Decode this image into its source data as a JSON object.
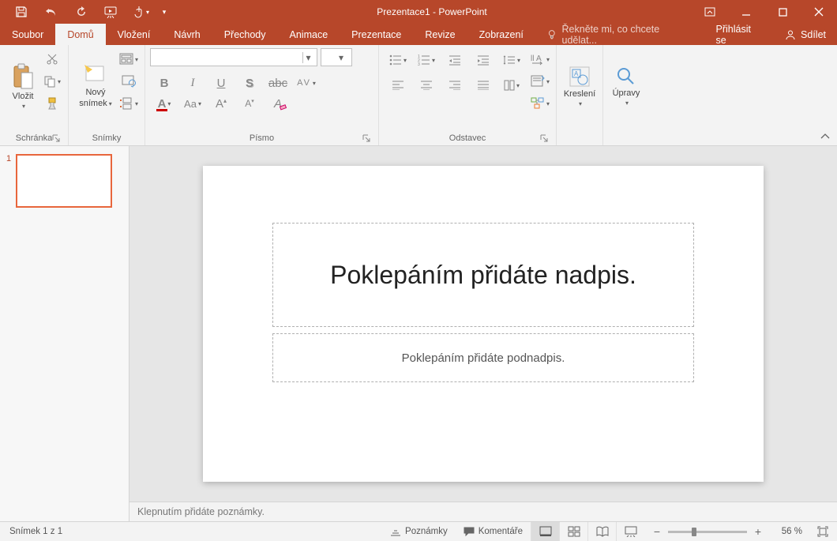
{
  "title": "Prezentace1 - PowerPoint",
  "tabs": {
    "file": "Soubor",
    "home": "Domů",
    "insert": "Vložení",
    "design": "Návrh",
    "transitions": "Přechody",
    "animations": "Animace",
    "slideshow": "Prezentace",
    "review": "Revize",
    "view": "Zobrazení"
  },
  "tellme": "Řekněte mi, co chcete udělat...",
  "signin": "Přihlásit se",
  "share": "Sdílet",
  "groups": {
    "clipboard": "Schránka",
    "slides": "Snímky",
    "font": "Písmo",
    "paragraph": "Odstavec",
    "drawing": "Kreslení",
    "editing": "Úpravy"
  },
  "buttons": {
    "paste": "Vložit",
    "newslide_l1": "Nový",
    "newslide_l2": "snímek",
    "drawing": "Kreslení",
    "editing": "Úpravy"
  },
  "slide": {
    "title_ph": "Poklepáním přidáte nadpis.",
    "subtitle_ph": "Poklepáním přidáte podnadpis."
  },
  "thumbs": {
    "n1": "1"
  },
  "notes_ph": "Klepnutím přidáte poznámky.",
  "status": {
    "left": "Snímek 1 z 1",
    "notes": "Poznámky",
    "comments": "Komentáře",
    "zoom": "56 %"
  }
}
